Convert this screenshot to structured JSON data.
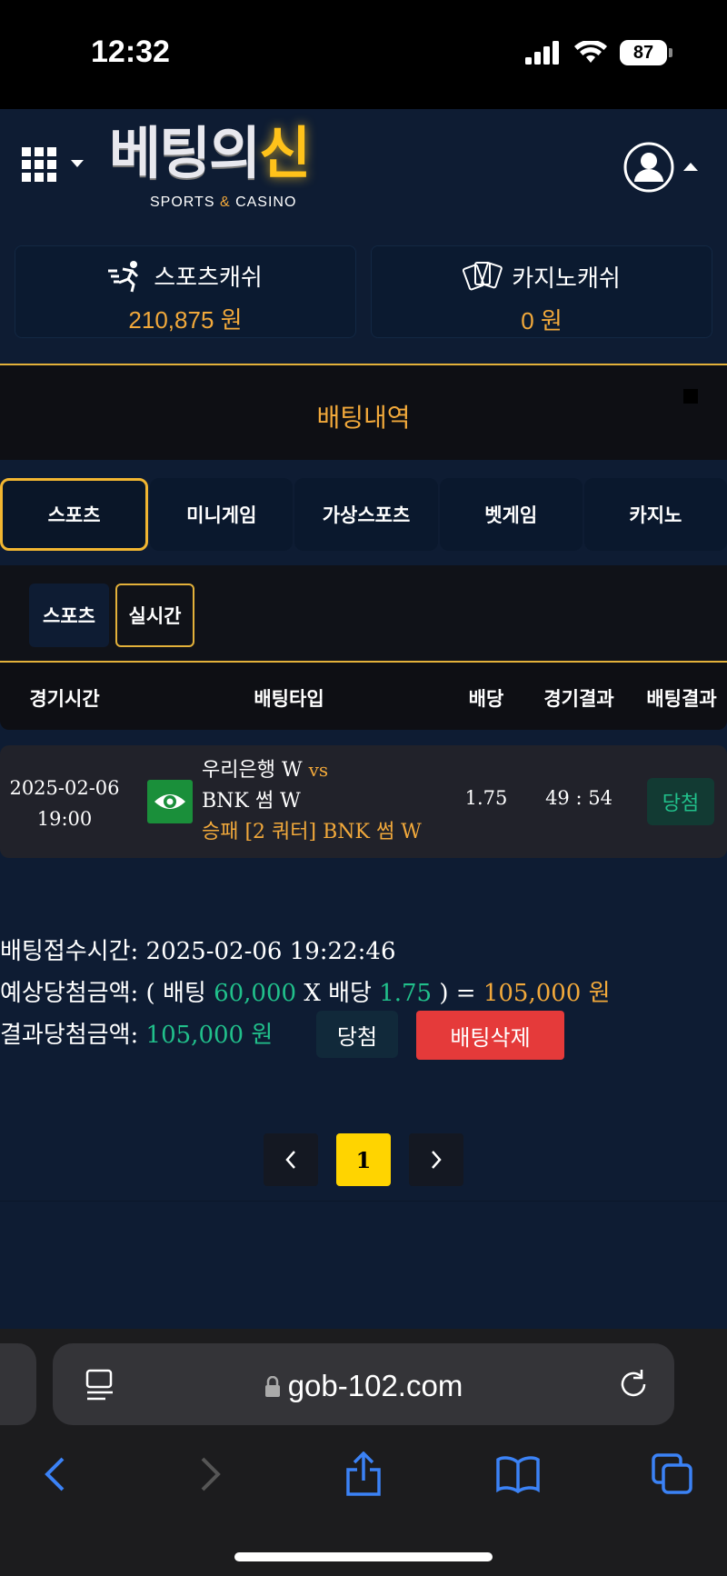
{
  "status_bar": {
    "time": "12:32",
    "battery": "87"
  },
  "header": {
    "logo": {
      "part1": "베팅의",
      "part2": "신",
      "sub_left": "SPORTS ",
      "sub_amp": "&",
      "sub_right": " CASINO"
    }
  },
  "wallets": {
    "sports": {
      "label": "스포츠캐쉬",
      "amount": "210,875 원"
    },
    "casino": {
      "label": "카지노캐쉬",
      "amount": "0 원"
    }
  },
  "page_title": "배팅내역",
  "tabs": [
    {
      "label": "스포츠",
      "active": true
    },
    {
      "label": "미니게임",
      "active": false
    },
    {
      "label": "가상스포츠",
      "active": false
    },
    {
      "label": "벳게임",
      "active": false
    },
    {
      "label": "카지노",
      "active": false
    }
  ],
  "subtabs": [
    {
      "label": "스포츠"
    },
    {
      "label": "실시간"
    }
  ],
  "table": {
    "headers": [
      "경기시간",
      "배팅타입",
      "배당",
      "경기결과",
      "배팅결과"
    ],
    "rows": [
      {
        "date": "2025-02-06",
        "time": "19:00",
        "home": "우리은행 W",
        "vs": "vs",
        "away": "BNK 썸 W",
        "pick": "승패 [2 쿼터] BNK 썸 W",
        "odds": "1.75",
        "score": "49 : 54",
        "result": "당첨"
      }
    ]
  },
  "details": {
    "received_label": "배팅접수시간:",
    "received_value": "2025-02-06 19:22:46",
    "expected_label": "예상당첨금액:",
    "expected_open": "( 배팅",
    "stake": "60,000",
    "times": "X 배당",
    "odds": "1.75",
    "expected_close": ") =",
    "expected_amount": "105,000 원",
    "result_label": "결과당첨금액:",
    "result_amount": "105,000 원",
    "won_button": "당첨",
    "delete_button": "배팅삭제"
  },
  "pagination": {
    "prev": "‹",
    "current": "1",
    "next": "›"
  },
  "browser": {
    "url": "gob-102.com"
  },
  "colors": {
    "accent": "#f2a93b",
    "win": "#21c08b",
    "danger": "#e53a3a",
    "page_bg": "#0e1c33"
  }
}
